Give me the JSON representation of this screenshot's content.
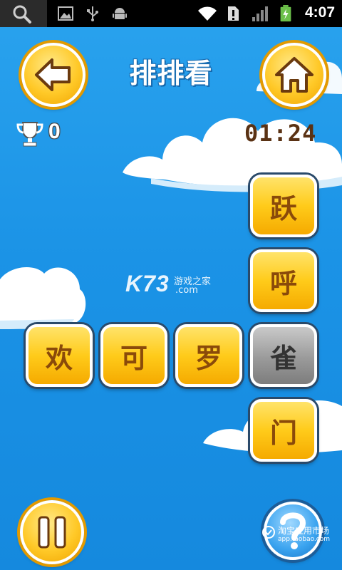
{
  "status_bar": {
    "time": "4:07",
    "icons": [
      "search-icon",
      "image-icon",
      "usb-icon",
      "android-icon",
      "wifi-icon",
      "alert-icon",
      "signal-icon",
      "battery-charging-icon"
    ]
  },
  "header": {
    "title": "排排看",
    "back_icon": "arrow-left-icon",
    "home_icon": "home-icon"
  },
  "hud": {
    "score": "0",
    "score_icon": "trophy-icon",
    "timer": "01:24"
  },
  "tiles": [
    {
      "char": "跃",
      "state": "normal"
    },
    {
      "char": "呼",
      "state": "normal"
    },
    {
      "char": "欢",
      "state": "normal"
    },
    {
      "char": "可",
      "state": "normal"
    },
    {
      "char": "罗",
      "state": "normal"
    },
    {
      "char": "雀",
      "state": "selected"
    },
    {
      "char": "门",
      "state": "normal"
    }
  ],
  "watermarks": {
    "k73_logo": "K73",
    "k73_cn": "游戏之家",
    "k73_domain": ".com",
    "taobao_cn": "淘宝应用市场",
    "taobao_en": "app.taobao.com"
  },
  "footer": {
    "pause_icon": "pause-icon",
    "help_icon": "question-icon"
  },
  "colors": {
    "sky": "#1b93e6",
    "tile_yellow": "#ffcb1a",
    "tile_selected": "#9a9a9a",
    "tile_text": "#8a4a0a",
    "timer_text": "#5a3214"
  }
}
